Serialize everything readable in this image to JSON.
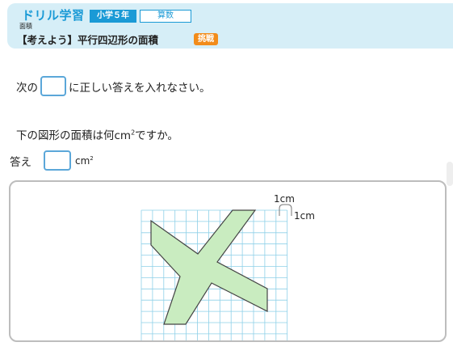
{
  "header": {
    "app_title": "ドリル学習",
    "grade": "小学５年",
    "subject": "算数",
    "unit": "面積",
    "lesson_title": "【考えよう】平行四辺形の面積",
    "challenge": "挑戦"
  },
  "instruction": {
    "before": "次の",
    "after": "に正しい答えを入れなさい。"
  },
  "question": {
    "text": "下の図形の面積は何",
    "unit": "cm",
    "exp": "2",
    "tail": "ですか。"
  },
  "answer": {
    "label": "答え",
    "value": "",
    "unit": "cm",
    "exp": "2"
  },
  "figure": {
    "scale_horizontal": "1cm",
    "scale_vertical": "1cm",
    "fill_color": "#c9ecc0",
    "grid_color": "#8ed0e8"
  }
}
